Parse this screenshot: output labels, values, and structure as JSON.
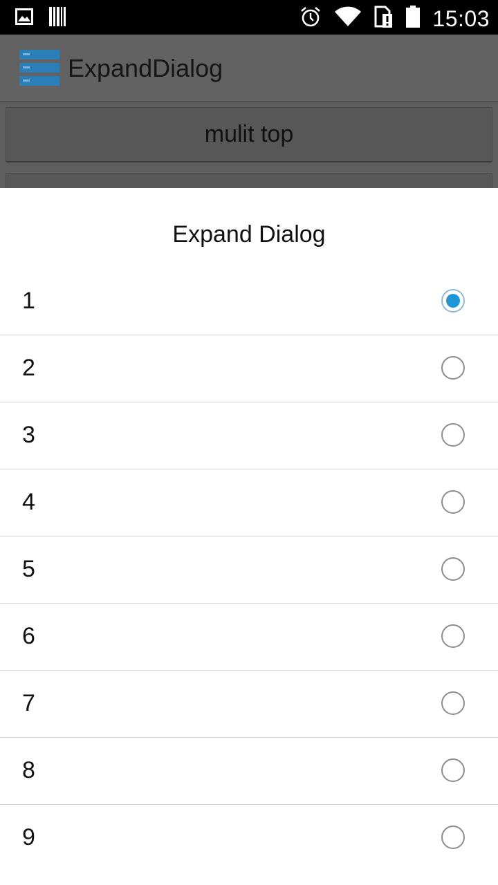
{
  "status_bar": {
    "time": "15:03",
    "icons": [
      "picture-icon",
      "barcode-icon",
      "alarm-icon",
      "wifi-icon",
      "sim-alert-icon",
      "battery-icon"
    ]
  },
  "app_bar": {
    "title": "ExpandDialog",
    "logo_icon": "server-stack-icon",
    "logo_color": "#2a7fb8"
  },
  "main": {
    "button_label": "mulit top"
  },
  "dialog": {
    "title": "Expand Dialog",
    "accent_color": "#1f97d4",
    "selected_index": 0,
    "items": [
      {
        "label": "1",
        "checked": true
      },
      {
        "label": "2",
        "checked": false
      },
      {
        "label": "3",
        "checked": false
      },
      {
        "label": "4",
        "checked": false
      },
      {
        "label": "5",
        "checked": false
      },
      {
        "label": "6",
        "checked": false
      },
      {
        "label": "7",
        "checked": false
      },
      {
        "label": "8",
        "checked": false
      },
      {
        "label": "9",
        "checked": false
      }
    ]
  }
}
